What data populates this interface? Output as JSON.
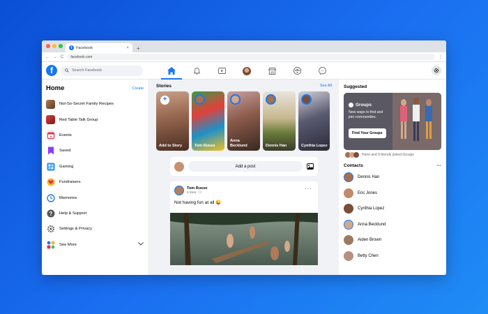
{
  "browser": {
    "tab_title": "Facebook",
    "tab_close": "×",
    "new_tab": "+",
    "nav_back": "←",
    "nav_forward": "→",
    "nav_reload": "C",
    "url": "facebook.com",
    "menu_dots": "⋮"
  },
  "topbar": {
    "logo": "f",
    "search_placeholder": "Search Facebook"
  },
  "left": {
    "title": "Home",
    "create": "Create",
    "items": [
      {
        "label": "Not-So-Secret Family Recipes",
        "color": "#8a5a3a"
      },
      {
        "label": "Red Table Talk Group",
        "color": "#b22a2a"
      },
      {
        "label": "Events",
        "color": "#f02849"
      },
      {
        "label": "Saved",
        "color": "#8b3dff"
      },
      {
        "label": "Gaming",
        "color": "#1e90ff"
      },
      {
        "label": "Fundraisers",
        "color": "#f5533d"
      },
      {
        "label": "Memories",
        "color": "#2a78d8"
      },
      {
        "label": "Help & Support",
        "color": "#555"
      },
      {
        "label": "Settings & Privacy",
        "color": "#555"
      },
      {
        "label": "See More",
        "color": "#1877f2"
      }
    ]
  },
  "stories": {
    "title": "Stories",
    "see_all": "See All",
    "items": [
      {
        "name": "Add to Story"
      },
      {
        "name": "Tom Russo"
      },
      {
        "name": "Anna Becklund"
      },
      {
        "name": "Dennis Han"
      },
      {
        "name": "Cynthia Lopez"
      }
    ]
  },
  "composer": {
    "placeholder": "Add a post"
  },
  "post": {
    "author": "Tom Russo",
    "time": "5 mins",
    "text": "Not having fun at all 😜",
    "more": "···"
  },
  "suggested": {
    "title": "Suggested",
    "group_title": "Groups",
    "group_desc": "New ways to find and join communities.",
    "group_button": "Find Your Groups",
    "friends_text": "Henri and 9 friends joined Groups"
  },
  "contacts": {
    "title": "Contacts",
    "more": "···",
    "items": [
      {
        "name": "Dennis Han",
        "color": "#a57050"
      },
      {
        "name": "Eric Jones",
        "color": "#c08a6a"
      },
      {
        "name": "Cynthia Lopez",
        "color": "#7a4e3a"
      },
      {
        "name": "Anna Becklund",
        "color": "#d4a88a"
      },
      {
        "name": "Aiden Brown",
        "color": "#9a7a60"
      },
      {
        "name": "Betty Chen",
        "color": "#b59080"
      }
    ]
  }
}
